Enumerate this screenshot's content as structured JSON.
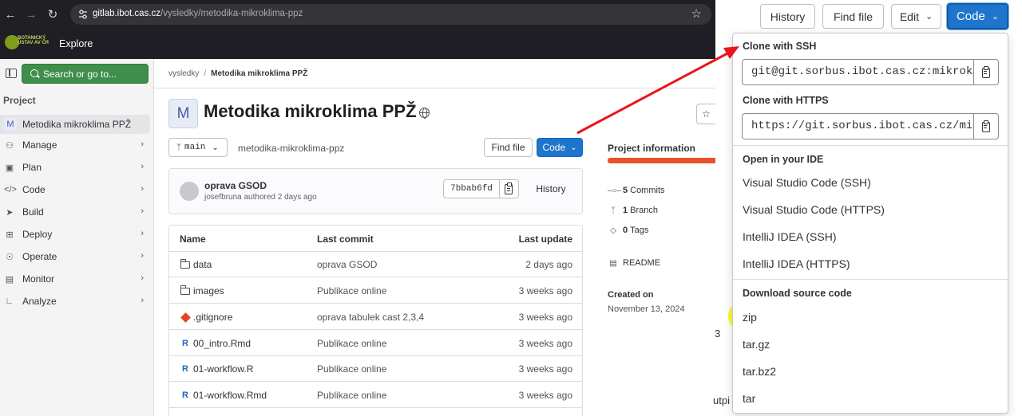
{
  "browser": {
    "url_host": "gitlab.ibot.cas.cz",
    "url_path": "/vysledky/metodika-mikroklima-ppz"
  },
  "header": {
    "logo_text": "BOTANICKÝ ÚSTAV AV ČR",
    "explore_label": "Explore"
  },
  "sidebar": {
    "search_label": "Search or go to...",
    "section_title": "Project",
    "project_badge": "M",
    "project_name": "Metodika mikroklima PPŽ",
    "items": [
      {
        "label": "Manage",
        "icon": "users-icon"
      },
      {
        "label": "Plan",
        "icon": "calendar-icon"
      },
      {
        "label": "Code",
        "icon": "code-icon"
      },
      {
        "label": "Build",
        "icon": "rocket-icon"
      },
      {
        "label": "Deploy",
        "icon": "deploy-icon"
      },
      {
        "label": "Operate",
        "icon": "cloud-icon"
      },
      {
        "label": "Monitor",
        "icon": "monitor-icon"
      },
      {
        "label": "Analyze",
        "icon": "chart-icon"
      }
    ]
  },
  "breadcrumb": {
    "parent": "vysledky",
    "separator": "/",
    "current": "Metodika mikroklima PPŽ"
  },
  "project": {
    "avatar_letter": "M",
    "title": "Metodika mikroklima PPŽ",
    "branch": "main",
    "path": "metodika-mikroklima-ppz",
    "find_file_label": "Find file",
    "code_label": "Code"
  },
  "commit": {
    "title": "oprava GSOD",
    "author": "josefbruna",
    "meta": "josefbruna authored 2 days ago",
    "sha": "7bbab6fd",
    "history_label": "History"
  },
  "file_table": {
    "headers": [
      "Name",
      "Last commit",
      "Last update"
    ],
    "rows": [
      {
        "name": "data",
        "type": "folder",
        "commit": "oprava GSOD",
        "updated": "2 days ago"
      },
      {
        "name": "images",
        "type": "folder",
        "commit": "Publikace online",
        "updated": "3 weeks ago"
      },
      {
        "name": ".gitignore",
        "type": "git",
        "commit": "oprava tabulek cast 2,3,4",
        "updated": "3 weeks ago"
      },
      {
        "name": "00_intro.Rmd",
        "type": "r",
        "commit": "Publikace online",
        "updated": "3 weeks ago"
      },
      {
        "name": "01-workflow.R",
        "type": "r",
        "commit": "Publikace online",
        "updated": "3 weeks ago"
      },
      {
        "name": "01-workflow.Rmd",
        "type": "r",
        "commit": "Publikace online",
        "updated": "3 weeks ago"
      }
    ]
  },
  "info_panel": {
    "title": "Project information",
    "commits_count": "5",
    "commits_label": "Commits",
    "branch_count": "1",
    "branch_label": "Branch",
    "tags_count": "0",
    "tags_label": "Tags",
    "readme_label": "README",
    "created_label": "Created on",
    "created_date": "November 13, 2024",
    "stray_number": "3",
    "stray_text": "utpi"
  },
  "top_buttons": {
    "history": "History",
    "find_file": "Find file",
    "edit": "Edit",
    "code": "Code"
  },
  "dropdown": {
    "ssh_heading": "Clone with SSH",
    "ssh_url": "git@git.sorbus.ibot.cas.cz:mikroklima",
    "https_heading": "Clone with HTTPS",
    "https_url": "https://git.sorbus.ibot.cas.cz/mikroklima",
    "ide_heading": "Open in your IDE",
    "ide_items": [
      "Visual Studio Code (SSH)",
      "Visual Studio Code (HTTPS)",
      "IntelliJ IDEA (SSH)",
      "IntelliJ IDEA (HTTPS)"
    ],
    "download_heading": "Download source code",
    "download_items": [
      "zip",
      "tar.gz",
      "tar.bz2",
      "tar"
    ]
  },
  "colors": {
    "accent_blue": "#1f75cb",
    "highlight_yellow": "#fbfb2a",
    "annotation_red": "#e8151b",
    "search_green": "#3f8e4b"
  }
}
